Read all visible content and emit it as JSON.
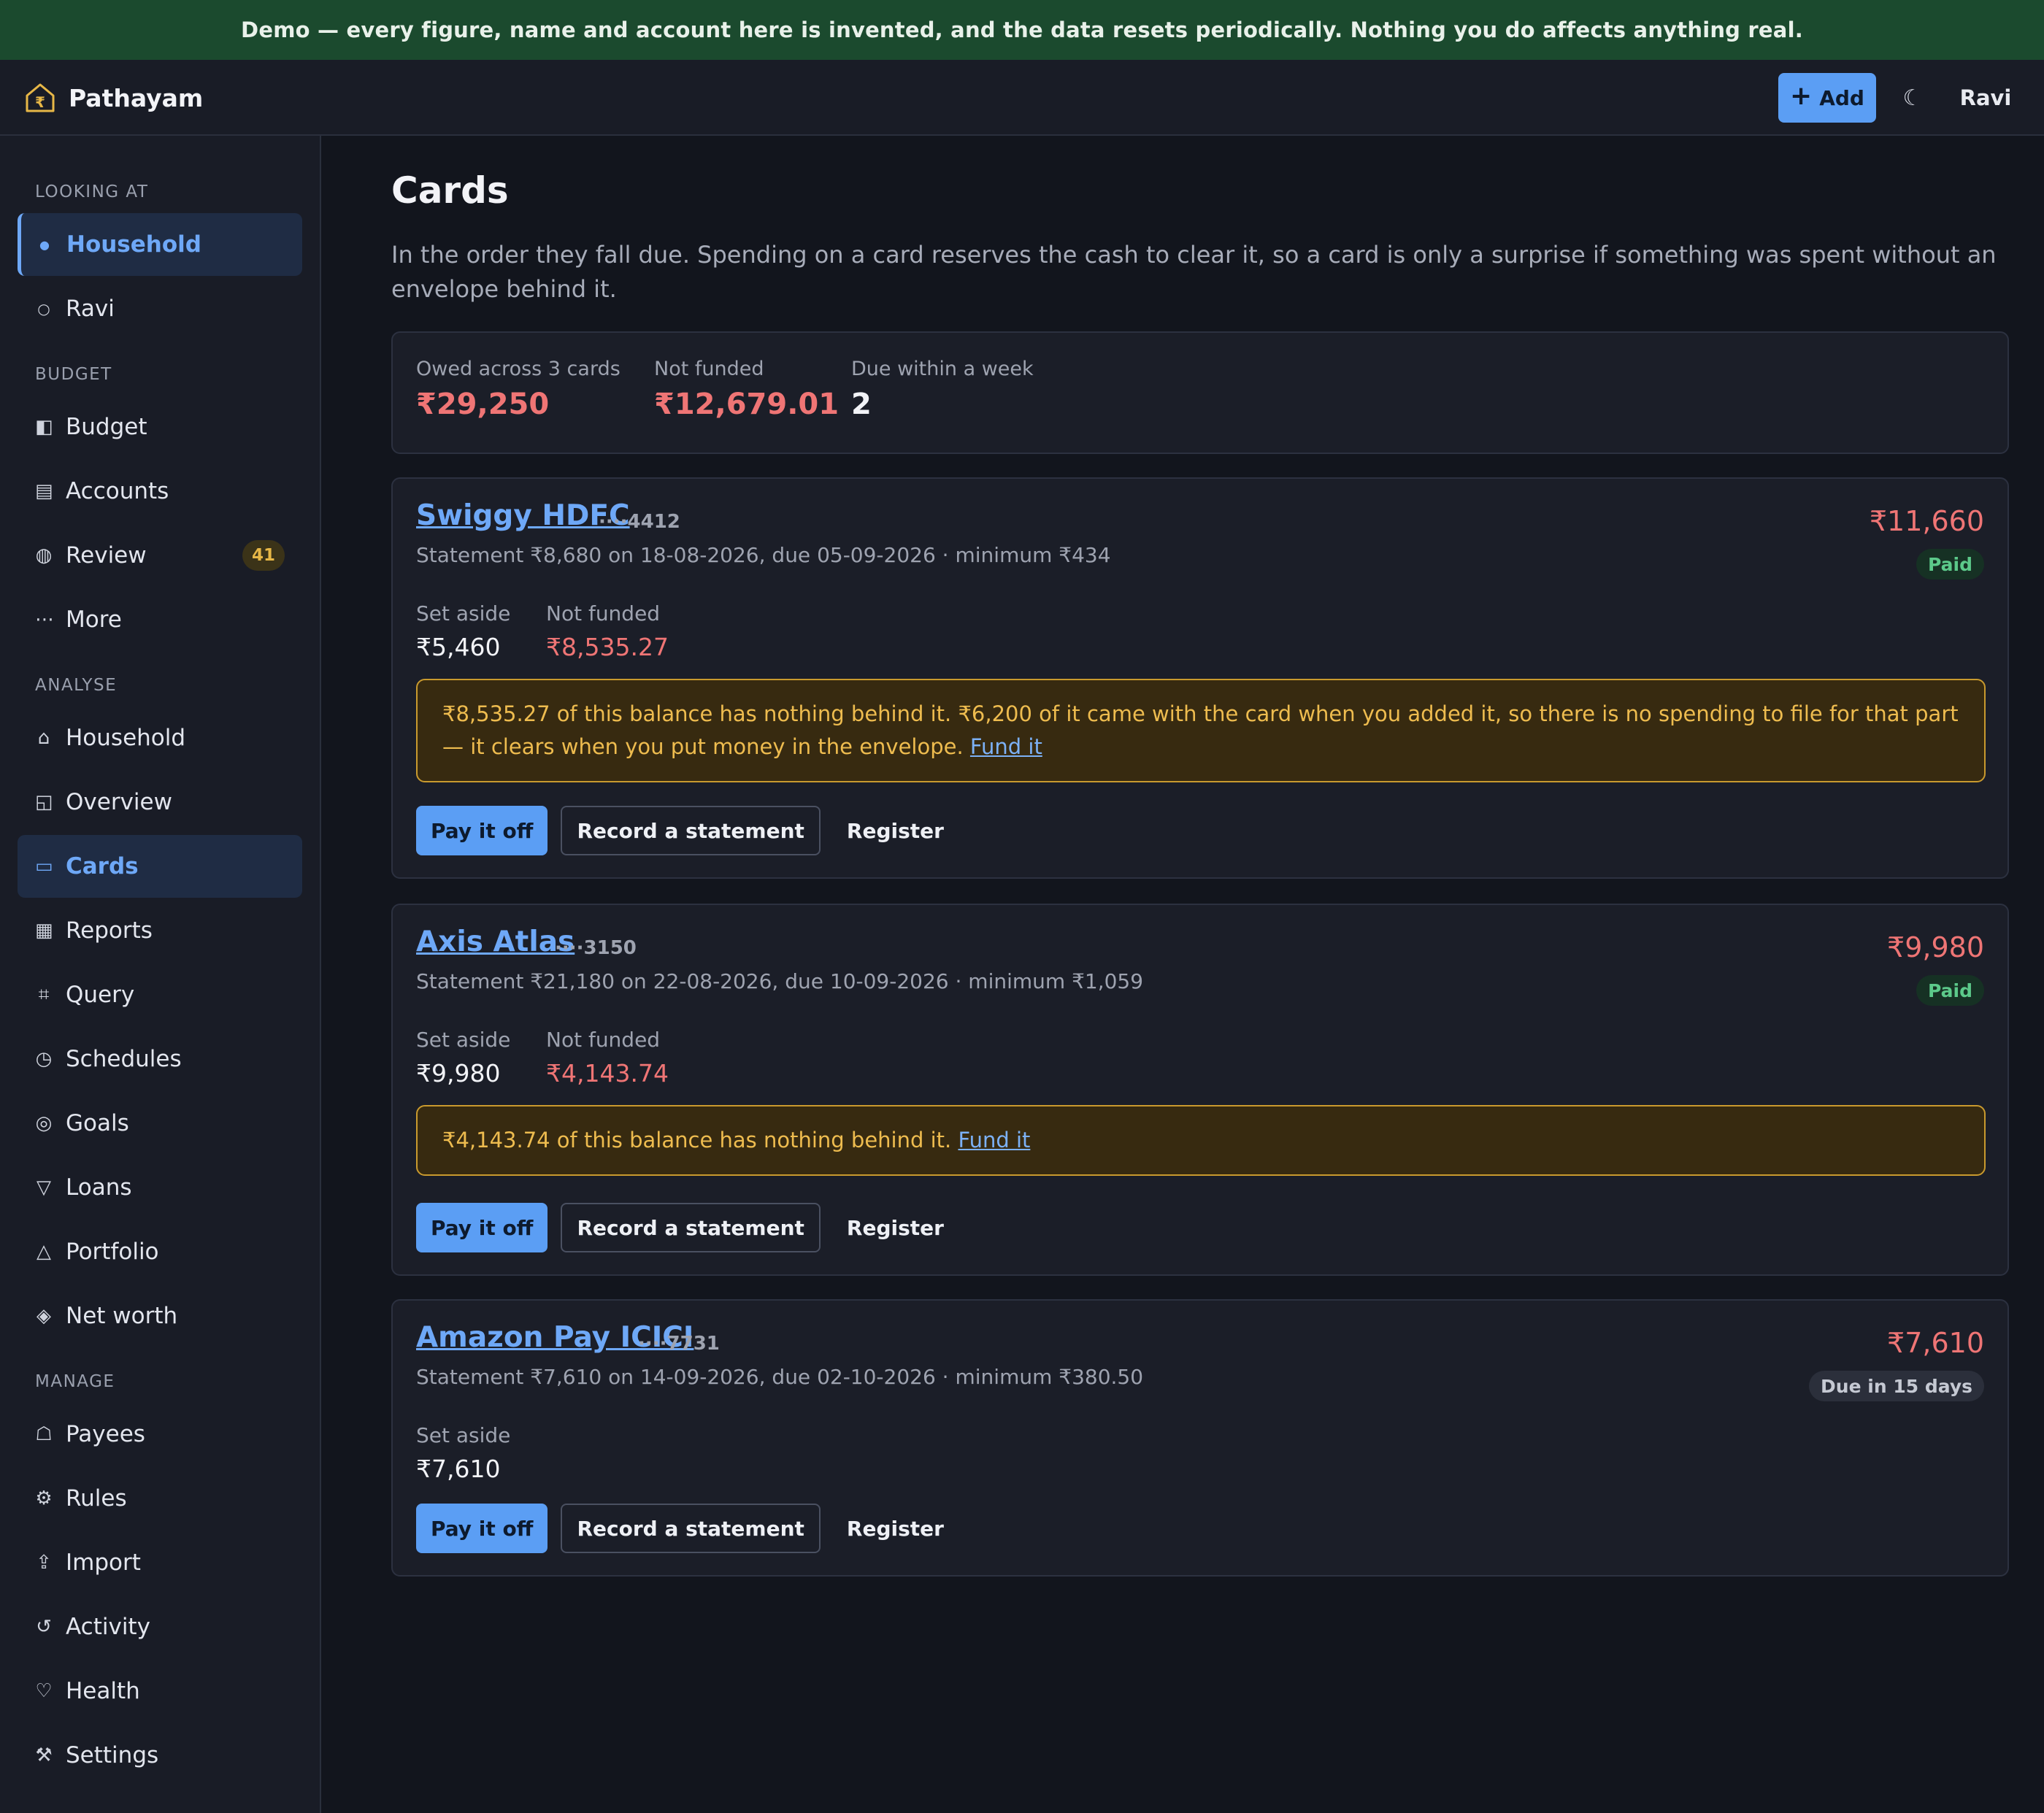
{
  "banner": "Demo — every figure, name and account here is invented, and the data resets periodically. Nothing you do affects anything real.",
  "app": {
    "name": "Pathayam"
  },
  "topbar": {
    "add_label": "Add",
    "theme_glyph": "☾",
    "user": "Ravi"
  },
  "sidebar": {
    "looking_at": {
      "heading": "LOOKING AT",
      "items": [
        {
          "label": "Household",
          "glyph": "●"
        },
        {
          "label": "Ravi",
          "glyph": "○"
        }
      ]
    },
    "budget": {
      "heading": "BUDGET",
      "items": [
        {
          "label": "Budget",
          "glyph": "◧"
        },
        {
          "label": "Accounts",
          "glyph": "▤"
        },
        {
          "label": "Review",
          "glyph": "◍",
          "badge": "41"
        },
        {
          "label": "More",
          "glyph": "⋯"
        }
      ]
    },
    "analyse": {
      "heading": "ANALYSE",
      "items": [
        {
          "label": "Household",
          "glyph": "⌂"
        },
        {
          "label": "Overview",
          "glyph": "◱"
        },
        {
          "label": "Cards",
          "glyph": "▭"
        },
        {
          "label": "Reports",
          "glyph": "▦"
        },
        {
          "label": "Query",
          "glyph": "⌗"
        },
        {
          "label": "Schedules",
          "glyph": "◷"
        },
        {
          "label": "Goals",
          "glyph": "◎"
        },
        {
          "label": "Loans",
          "glyph": "▽"
        },
        {
          "label": "Portfolio",
          "glyph": "△"
        },
        {
          "label": "Net worth",
          "glyph": "◈"
        }
      ]
    },
    "manage": {
      "heading": "MANAGE",
      "items": [
        {
          "label": "Payees",
          "glyph": "☖"
        },
        {
          "label": "Rules",
          "glyph": "⚙"
        },
        {
          "label": "Import",
          "glyph": "⇪"
        },
        {
          "label": "Activity",
          "glyph": "↺"
        },
        {
          "label": "Health",
          "glyph": "♡"
        },
        {
          "label": "Settings",
          "glyph": "⚒"
        }
      ]
    }
  },
  "page": {
    "title": "Cards",
    "description": "In the order they fall due. Spending on a card reserves the cash to clear it, so a card is only a surprise if something was spent without an envelope behind it."
  },
  "summary": [
    {
      "label": "Owed across 3 cards",
      "value": "₹29,250"
    },
    {
      "label": "Not funded",
      "value": "₹12,679.01"
    },
    {
      "label": "Due within a week",
      "value": "2"
    }
  ],
  "cards": [
    {
      "name": "Swiggy HDFC",
      "mask": "····4412",
      "meta": "Statement ₹8,680 on 18-08-2026, due 05-09-2026 · minimum ₹434",
      "amount": "₹11,660",
      "status": "Paid",
      "set_aside_label": "Set aside",
      "set_aside": "₹5,460",
      "not_funded_label": "Not funded",
      "not_funded": "₹8,535.27",
      "warning": "₹8,535.27 of this balance has nothing behind it. ₹6,200 of it came with the card when you added it, so there is no spending to file for that part — it clears when you put money in the envelope.",
      "warning_link": "Fund it",
      "actions": {
        "pay": "Pay it off",
        "record": "Record a statement",
        "register": "Register"
      }
    },
    {
      "name": "Axis Atlas",
      "mask": "····3150",
      "meta": "Statement ₹21,180 on 22-08-2026, due 10-09-2026 · minimum ₹1,059",
      "amount": "₹9,980",
      "status": "Paid",
      "set_aside_label": "Set aside",
      "set_aside": "₹9,980",
      "not_funded_label": "Not funded",
      "not_funded": "₹4,143.74",
      "warning": "₹4,143.74 of this balance has nothing behind it.",
      "warning_link": "Fund it",
      "actions": {
        "pay": "Pay it off",
        "record": "Record a statement",
        "register": "Register"
      }
    },
    {
      "name": "Amazon Pay ICICI",
      "mask": "····7731",
      "meta": "Statement ₹7,610 on 14-09-2026, due 02-10-2026 · minimum ₹380.50",
      "amount": "₹7,610",
      "status": "Due in 15 days",
      "set_aside_label": "Set aside",
      "set_aside": "₹7,610",
      "actions": {
        "pay": "Pay it off",
        "record": "Record a statement",
        "register": "Register"
      }
    }
  ],
  "colors": {
    "background": "#12151d",
    "panel": "#1b1e28",
    "accent": "#5b9ef4",
    "danger": "#ef7575",
    "warning": "#eebc4f",
    "success": "#5cc98a",
    "banner": "#1b4a2e"
  }
}
